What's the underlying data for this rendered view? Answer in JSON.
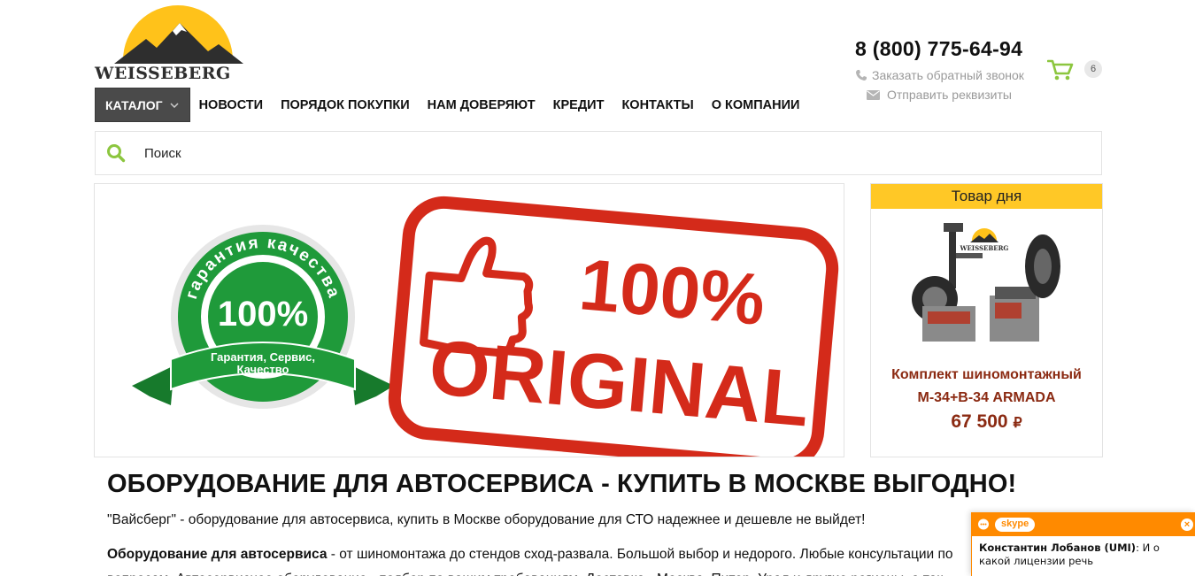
{
  "logo": {
    "text": "WEISSEBERG"
  },
  "header": {
    "phone": "8 (800) 775-64-94",
    "callback_label": "Заказать обратный звонок",
    "requisites_label": "Отправить реквизиты",
    "cart_count": "6"
  },
  "nav": {
    "catalog_label": "КАТАЛОГ",
    "items": [
      {
        "label": "НОВОСТИ"
      },
      {
        "label": "ПОРЯДОК ПОКУПКИ"
      },
      {
        "label": "НАМ ДОВЕРЯЮТ"
      },
      {
        "label": "КРЕДИТ"
      },
      {
        "label": "КОНТАКТЫ"
      },
      {
        "label": "О КОМПАНИИ"
      }
    ]
  },
  "search": {
    "placeholder": "Поиск"
  },
  "banner": {
    "seal_top": "гарантия качества",
    "seal_percent": "100%",
    "ribbon_line1": "Гарантия, Сервис,",
    "ribbon_line2": "Качество",
    "stamp_percent": "100%",
    "stamp_word": "ORIGINAL"
  },
  "deal": {
    "title": "Товар дня",
    "image_brand": "WEISSEBERG",
    "name_line1": "Комплект шиномонтажный",
    "name_line2": "М-34+В-34 ARMADA",
    "price": "67 500",
    "currency": "₽"
  },
  "content": {
    "heading": "ОБОРУДОВАНИЕ ДЛЯ АВТОСЕРВИСА - КУПИТЬ В МОСКВЕ ВЫГОДНО!",
    "intro": "\"Вайсберг\" - оборудование для автосервиса, купить в Москве оборудование для СТО надежнее и дешевле не выйдет!",
    "p2_bold": "Оборудование для автосервиса",
    "p2_text": " - от шиномонтажа до стендов сход-развала. Большой выбор и недорого. Любые консультации по вопросам. Автосервисное оборудование - подбор по вашим требованиям. Доставка - Москва, Питер, Урал и другие регионы, а так"
  },
  "skype": {
    "logo": "skype",
    "close": "×",
    "sender": "Константин Лобанов (UMI)",
    "message": ": И о какой лицензии речь"
  },
  "colors": {
    "accent_yellow": "#ffc826",
    "price_brown": "#8b2a12",
    "stamp_red": "#d42a1a",
    "seal_green": "#1f9a3a",
    "skype_orange": "#ff8a00",
    "cart_green": "#8cc63f"
  }
}
